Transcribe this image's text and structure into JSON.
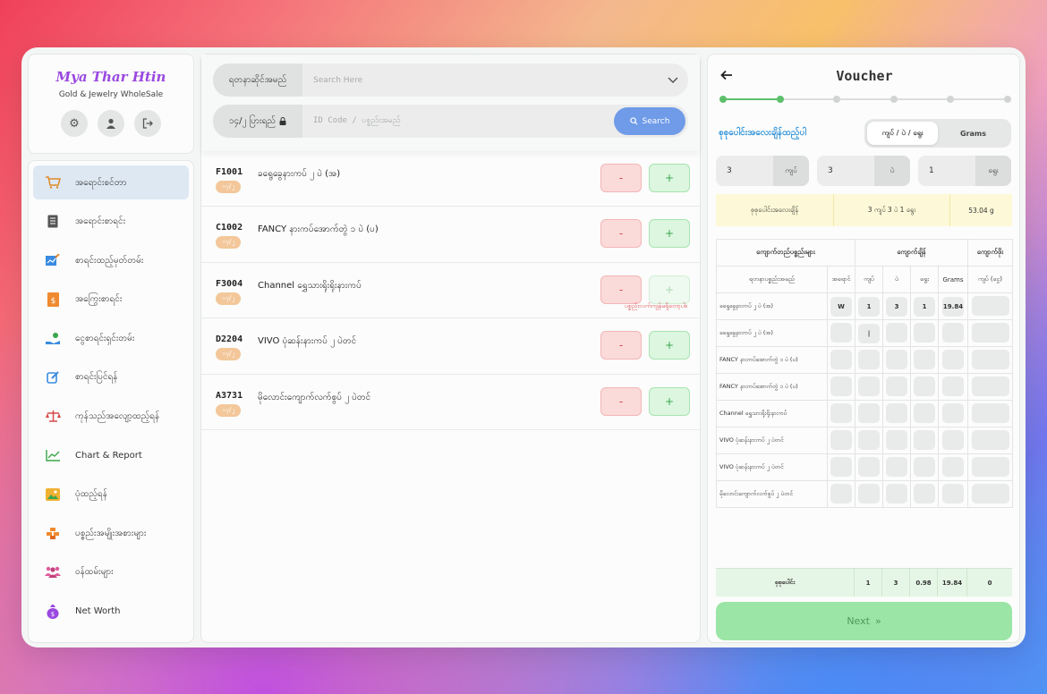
{
  "brand": {
    "name": "Mya Thar Htin",
    "subtitle": "Gold & Jewelry WholeSale",
    "icons": [
      "gear-icon",
      "user-icon",
      "logout-icon"
    ]
  },
  "sidebar": {
    "items": [
      {
        "label": "အရောင်းစင်တာ",
        "icon": "cart-icon",
        "active": true
      },
      {
        "label": "အရောင်းစာရင်း",
        "icon": "ledger-icon"
      },
      {
        "label": "စာရင်းထည့်မှတ်တမ်း",
        "icon": "chart-edit-icon"
      },
      {
        "label": "အကြွေးစာရင်း",
        "icon": "invoice-icon"
      },
      {
        "label": "ငွေစာရင်းရှင်းတမ်း",
        "icon": "hand-money-icon"
      },
      {
        "label": "စာရင်းပြင်ရန်",
        "icon": "edit-icon"
      },
      {
        "label": "ကုန်သည်အလျော့ထည့်ရန်",
        "icon": "scale-icon"
      },
      {
        "label": "Chart & Report",
        "icon": "line-chart-icon"
      },
      {
        "label": "ပုံထည့်ရန်",
        "icon": "image-icon"
      },
      {
        "label": "ပစ္စည်းအမျိုးအစားများ",
        "icon": "gold-bars-icon"
      },
      {
        "label": "ဝန်ထမ်းများ",
        "icon": "people-icon"
      },
      {
        "label": "Net Worth",
        "icon": "money-bag-icon"
      }
    ]
  },
  "search": {
    "name_label": "ရတနာဆိုင်အမည်",
    "name_placeholder": "Search Here",
    "type_label": "၁၄/၂ ပြားရည်",
    "code_placeholder": "ID Code / ပစ္စည်းအမည်",
    "button_label": "Search"
  },
  "products": [
    {
      "code": "F1001",
      "name": "ခရွေခွေနားကပ် ၂ ပဲ (အ)",
      "tag": "၁၄/၂",
      "warning": ""
    },
    {
      "code": "C1002",
      "name": "FANCY နားကပ်အောက်တွဲ ၁ ပဲ (ပ)",
      "tag": "၁၄/၂",
      "warning": ""
    },
    {
      "code": "F3004",
      "name": "Channel ရွှေသားရိုးရိုးနားကပ်",
      "tag": "၁၄/၂",
      "warning": "ပစ္စည်းလက်ကျန်မရှိတော့ပါ။",
      "plus_disabled": true
    },
    {
      "code": "D2204",
      "name": "VIVO ပုံဆန်းနားကပ် ၂ ပဲတင်",
      "tag": "၁၄/၂",
      "warning": ""
    },
    {
      "code": "A3731",
      "name": "မိုလောင်းကျောက်လက်စွပ် ၂ ပဲတင်",
      "tag": "၁၄/၂",
      "warning": ""
    }
  ],
  "buttons": {
    "minus": "-",
    "plus": "+"
  },
  "voucher": {
    "title": "Voucher",
    "back_icon": "arrow-left-icon",
    "steps_total": 6,
    "steps_done": 2,
    "weight_title": "စုစုပေါင်းအလေးချိန်ထည့်ပါ",
    "toggle": [
      "ကျပ် / ပဲ / ရွေး",
      "Grams"
    ],
    "inputs": [
      {
        "value": "3",
        "unit": "ကျပ်"
      },
      {
        "value": "3",
        "unit": "ပဲ"
      },
      {
        "value": "1",
        "unit": "ရွေး"
      }
    ],
    "summary": {
      "label": "စုစုပေါင်းအလေးချိန်",
      "value": "3 ကျပ် 3 ပဲ 1 ရွေး",
      "grams": "53.04 g"
    },
    "table": {
      "group_headers": [
        "ကျောက်တည်ပစ္စည်းများ",
        "ကျောက်ချိန်",
        "ကျောက်ဖိုး"
      ],
      "col_headers": [
        "ရတနာပစ္စည်းအမည်",
        "အရောင်",
        "ကျပ်",
        "ပဲ",
        "ရွေး",
        "Grams",
        "ကျပ် (ငွေ)"
      ],
      "rows": [
        {
          "name": "ခရွေခွေနားကပ် ၂ ပဲ (အ)",
          "vals": [
            "W",
            "1",
            "3",
            "1",
            "19.84",
            ""
          ]
        },
        {
          "name": "ခရွေခွေနားကပ် ၂ ပဲ (အ)",
          "vals": [
            "",
            "|",
            "",
            "",
            "",
            ""
          ]
        },
        {
          "name": "FANCY နားကပ်အောက်တွဲ ၁ ပဲ (ပ)",
          "vals": [
            "",
            "",
            "",
            "",
            "",
            ""
          ]
        },
        {
          "name": "FANCY နားကပ်အောက်တွဲ ၁ ပဲ (ပ)",
          "vals": [
            "",
            "",
            "",
            "",
            "",
            ""
          ]
        },
        {
          "name": "Channel ရွှေသားရိုးရိုးနားကပ်",
          "vals": [
            "",
            "",
            "",
            "",
            "",
            ""
          ]
        },
        {
          "name": "VIVO ပုံဆန်းနားကပ် ၂ ပဲတင်",
          "vals": [
            "",
            "",
            "",
            "",
            "",
            ""
          ]
        },
        {
          "name": "VIVO ပုံဆန်းနားကပ် ၂ ပဲတင်",
          "vals": [
            "",
            "",
            "",
            "",
            "",
            ""
          ]
        },
        {
          "name": "မိုလောင်းကျောက်လက်စွပ် ၂ ပဲတင်",
          "vals": [
            "",
            "",
            "",
            "",
            "",
            ""
          ]
        }
      ]
    },
    "totals": {
      "label": "စုစုပေါင်း",
      "vals": [
        "1",
        "3",
        "0.98",
        "19.84",
        "0"
      ]
    },
    "next_label": "Next"
  }
}
